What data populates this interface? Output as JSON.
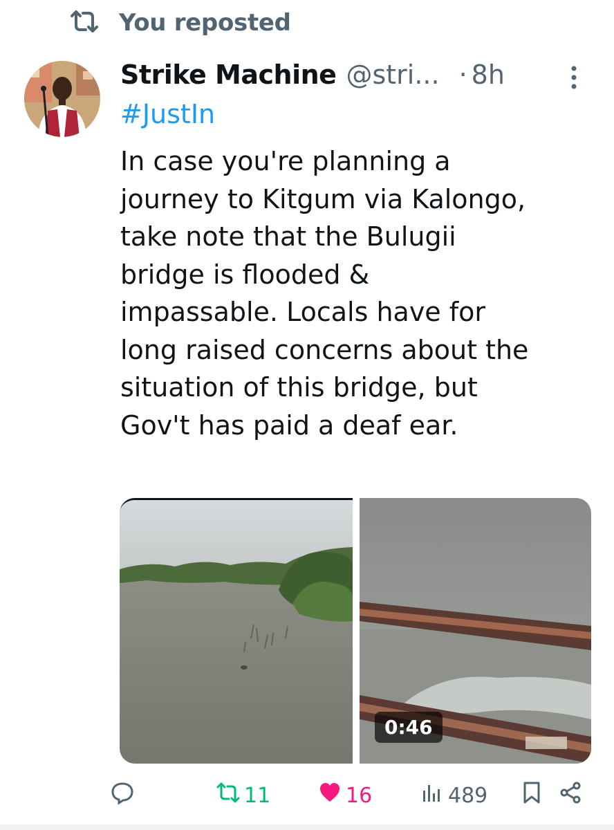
{
  "repost_banner": {
    "icon": "repost-icon",
    "text": "You reposted"
  },
  "tweet": {
    "author_name": "Strike Machine",
    "handle": "@stri...",
    "separator": "·",
    "time": "8h",
    "hashtag": "#JustIn",
    "text": "In case you're planning a\njourney to Kitgum via Kalongo,\ntake note that the Bulugii\nbridge is flooded &\nimpassable. Locals have for\nlong raised concerns about the\nsituation of this bridge, but\nGov't has paid a deaf ear.",
    "video_duration": "0:46"
  },
  "actions": {
    "reply": {
      "icon": "reply-icon"
    },
    "repost": {
      "icon": "repost-icon",
      "count": "11",
      "color": "#00ba7c"
    },
    "like": {
      "icon": "heart-icon",
      "count": "16",
      "color": "#f91880"
    },
    "views": {
      "icon": "views-icon",
      "count": "489"
    },
    "bookmark": {
      "icon": "bookmark-icon"
    },
    "share": {
      "icon": "share-icon"
    }
  },
  "colors": {
    "accent": "#1d9bf0",
    "secondary_text": "#536471",
    "text": "#0f1419"
  }
}
